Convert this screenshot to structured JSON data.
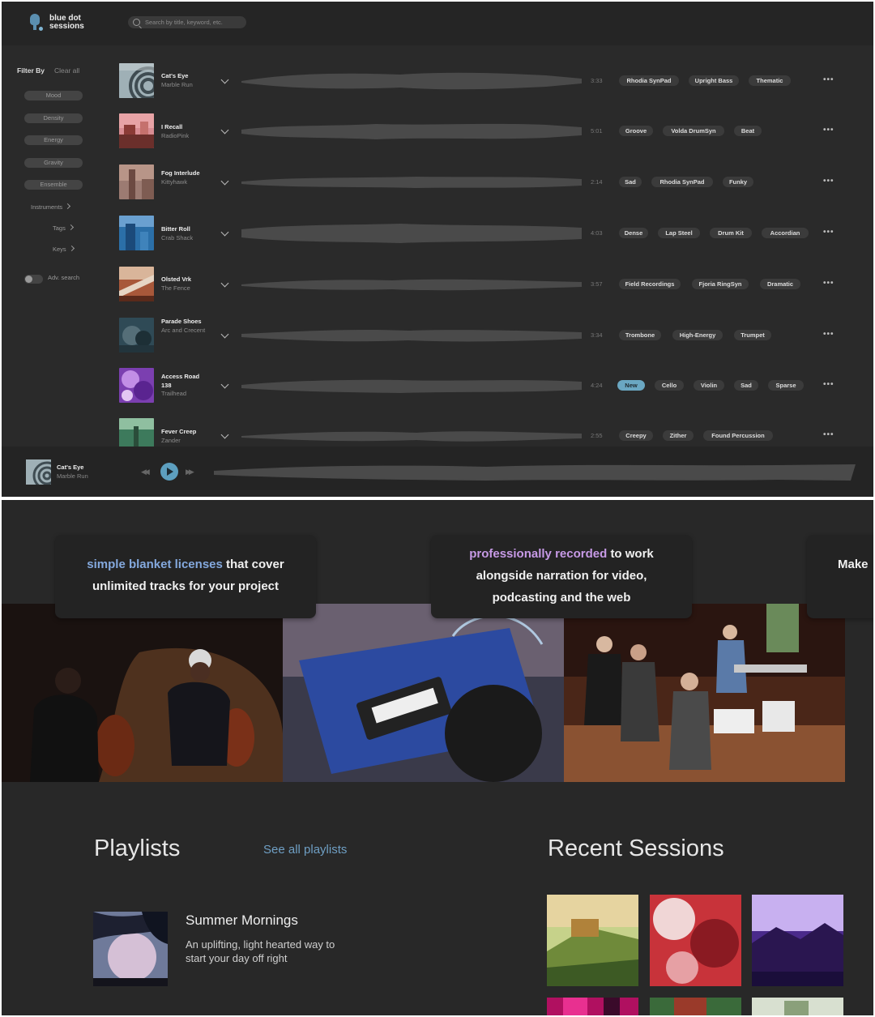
{
  "header": {
    "logo_line1": "blue dot",
    "logo_line2": "sessions",
    "search_placeholder": "Search by title, keyword, etc."
  },
  "sidebar": {
    "filter_title": "Filter By",
    "clear_all": "Clear all",
    "pills": [
      "Mood",
      "Density",
      "Energy",
      "Gravity",
      "Ensemble"
    ],
    "links": [
      "Instruments",
      "Tags",
      "Keys"
    ],
    "adv_search": "Adv. search"
  },
  "tracks": [
    {
      "title": "Cat's Eye",
      "artist": "Marble Run",
      "duration": "3:33",
      "tags": [
        "Rhodia SynPad",
        "Upright Bass",
        "Thematic"
      ]
    },
    {
      "title": "I Recall",
      "artist": "RadioPink",
      "duration": "5:01",
      "tags": [
        "Groove",
        "Volda DrumSyn",
        "Beat"
      ]
    },
    {
      "title": "Fog Interlude",
      "artist": "Kittyhawk",
      "duration": "2:14",
      "tags": [
        "Sad",
        "Rhodia SynPad",
        "Funky"
      ]
    },
    {
      "title": "Bitter Roll",
      "artist": "Crab Shack",
      "duration": "4:03",
      "tags": [
        "Dense",
        "Lap Steel",
        "Drum Kit",
        "Accordian"
      ]
    },
    {
      "title": "Olsted Vrk",
      "artist": "The Fence",
      "duration": "3:57",
      "tags": [
        "Field Recordings",
        "Fjoria RingSyn",
        "Dramatic"
      ]
    },
    {
      "title": "Parade Shoes",
      "artist": "Arc and Crecent",
      "duration": "3:34",
      "tags": [
        "Trombone",
        "High-Energy",
        "Trumpet"
      ]
    },
    {
      "title": "Access Road 138",
      "artist": "Trailhead",
      "duration": "4:24",
      "tags": [
        "New",
        "Cello",
        "Violin",
        "Sad",
        "Sparse"
      ]
    },
    {
      "title": "Fever Creep",
      "artist": "Zander",
      "duration": "2:55",
      "tags": [
        "Creepy",
        "Zither",
        "Found Percussion"
      ]
    }
  ],
  "more_glyph": "•••",
  "player": {
    "title": "Cat's Eye",
    "artist": "Marble Run"
  },
  "cards": {
    "card1_highlight": "simple blanket licenses",
    "card1_rest_a": "that cover",
    "card1_rest_b": "unlimited tracks for your project",
    "card2_highlight": "professionally recorded",
    "card2_rest_a": "to work",
    "card2_rest_b": "alongside narration for video,",
    "card2_rest_c": "podcasting and the web",
    "card3_partial": "Make"
  },
  "playlists": {
    "heading": "Playlists",
    "see_all": "See all playlists",
    "item_title": "Summer Mornings",
    "item_desc": "An uplifting, light hearted way to start your day off right"
  },
  "recent": {
    "heading": "Recent Sessions"
  },
  "colors": {
    "accent": "#5d9fbf",
    "new_tag": "#6aa7c2",
    "highlight_blue": "#84a9de",
    "highlight_pink": "#c79ae6"
  }
}
